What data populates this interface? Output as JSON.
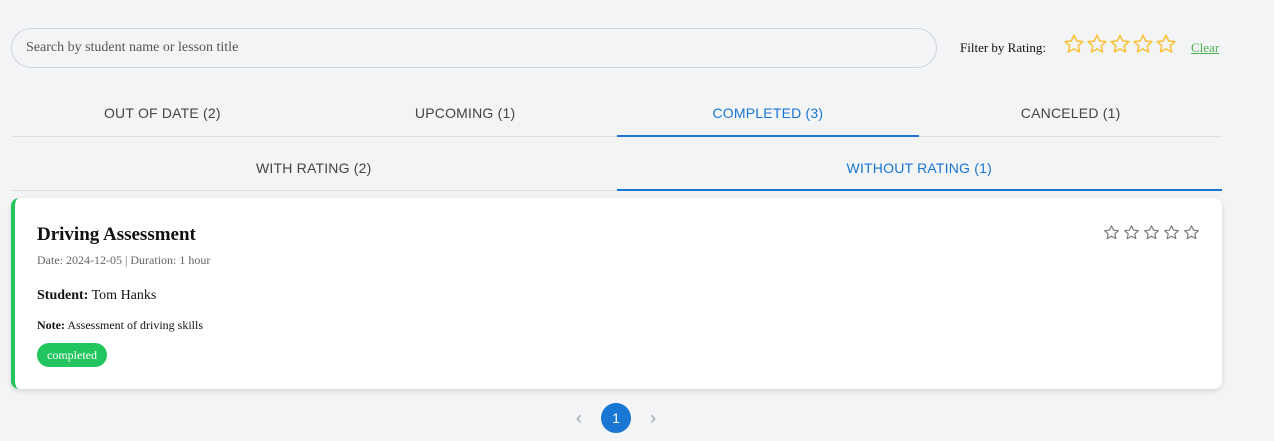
{
  "search": {
    "placeholder": "Search by student name or lesson title",
    "value": ""
  },
  "filter": {
    "label": "Filter by Rating:",
    "star_count": 5,
    "star_color": "#fbc02d",
    "clear_label": "Clear"
  },
  "primary_tabs": [
    {
      "label": "OUT OF DATE (2)",
      "active": false
    },
    {
      "label": "UPCOMING (1)",
      "active": false
    },
    {
      "label": "COMPLETED (3)",
      "active": true
    },
    {
      "label": "CANCELED (1)",
      "active": false
    }
  ],
  "secondary_tabs": [
    {
      "label": "WITH RATING (2)",
      "active": false
    },
    {
      "label": "WITHOUT RATING (1)",
      "active": true
    }
  ],
  "lesson": {
    "title": "Driving Assessment",
    "meta": "Date: 2024-12-05 | Duration: 1 hour",
    "student_label": "Student:",
    "student_name": "Tom Hanks",
    "note_label": "Note:",
    "note_text": "Assessment of driving skills",
    "status": "completed",
    "status_color": "#22c55e",
    "rating_star_count": 5
  },
  "pagination": {
    "prev_icon": "chevron-left-icon",
    "current_page": "1",
    "next_icon": "chevron-right-icon"
  },
  "colors": {
    "accent": "#1976d2",
    "success": "#22c55e"
  }
}
